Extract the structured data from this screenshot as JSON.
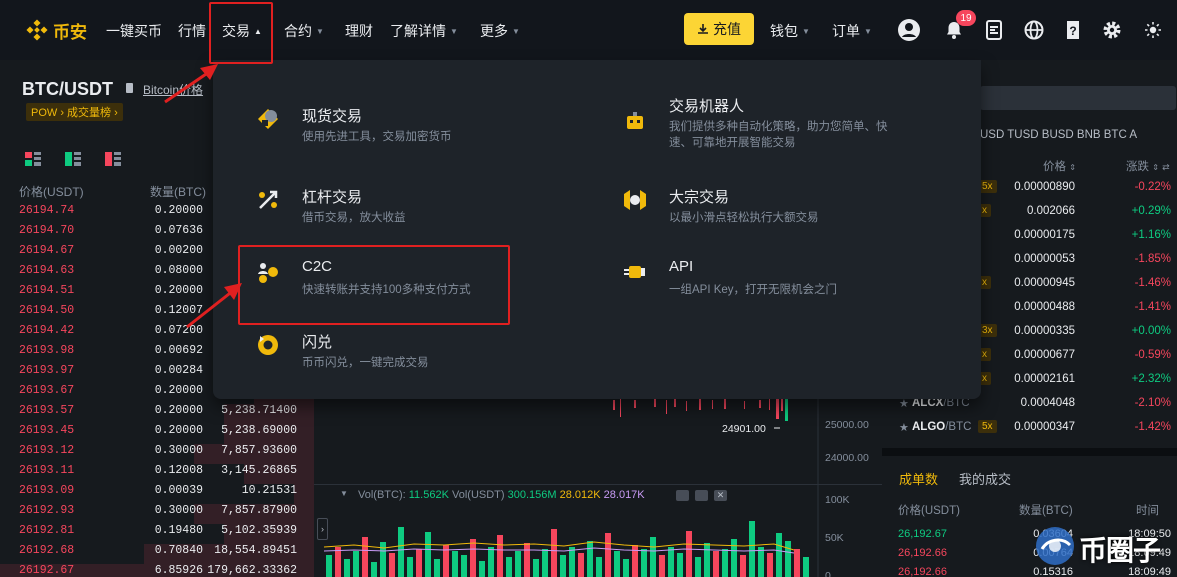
{
  "nav": {
    "logo_text": "币安",
    "items": [
      {
        "label": "一键买币",
        "caret": false
      },
      {
        "label": "行情",
        "caret": false
      },
      {
        "label": "交易",
        "caret": true,
        "active": true
      },
      {
        "label": "合约",
        "caret": true
      },
      {
        "label": "理财",
        "caret": false
      },
      {
        "label": "了解详情",
        "caret": true
      },
      {
        "label": "更多",
        "caret": true
      }
    ],
    "deposit_label": "充值",
    "wallet_label": "钱包",
    "orders_label": "订单",
    "notification_count": "19",
    "icons": [
      "user-icon",
      "bell-icon",
      "download-app-icon",
      "globe-icon",
      "help-icon",
      "settings-icon",
      "theme-icon"
    ],
    "colors": {
      "brand": "#f0b90b",
      "deposit_bg": "#fcd535",
      "badge": "#f6465d"
    }
  },
  "pair": {
    "symbol": "BTC/USDT",
    "link": "Bitcoin价格",
    "tag": "POW › 成交量榜 ›"
  },
  "orderbook": {
    "headers": {
      "price": "价格(USDT)",
      "qty": "数量(BTC)"
    },
    "rows": [
      {
        "price": "26194.74",
        "qty": "0.20000",
        "total": ""
      },
      {
        "price": "26194.70",
        "qty": "0.07636",
        "total": ""
      },
      {
        "price": "26194.67",
        "qty": "0.00200",
        "total": ""
      },
      {
        "price": "26194.63",
        "qty": "0.08000",
        "total": ""
      },
      {
        "price": "26194.51",
        "qty": "0.20000",
        "total": ""
      },
      {
        "price": "26194.50",
        "qty": "0.12007",
        "total": ""
      },
      {
        "price": "26194.42",
        "qty": "0.07200",
        "total": ""
      },
      {
        "price": "26193.98",
        "qty": "0.00692",
        "total": ""
      },
      {
        "price": "26193.97",
        "qty": "0.00284",
        "total": ""
      },
      {
        "price": "26193.67",
        "qty": "0.20000",
        "total": ""
      },
      {
        "price": "26193.57",
        "qty": "0.20000",
        "total": "5,238.71400"
      },
      {
        "price": "26193.45",
        "qty": "0.20000",
        "total": "5,238.69000"
      },
      {
        "price": "26193.12",
        "qty": "0.30000",
        "total": "7,857.93600"
      },
      {
        "price": "26193.11",
        "qty": "0.12008",
        "total": "3,145.26865"
      },
      {
        "price": "26193.09",
        "qty": "0.00039",
        "total": "10.21531"
      },
      {
        "price": "26192.93",
        "qty": "0.30000",
        "total": "7,857.87900"
      },
      {
        "price": "26192.81",
        "qty": "0.19480",
        "total": "5,102.35939"
      },
      {
        "price": "26192.68",
        "qty": "0.70840",
        "total": "18,554.89451"
      },
      {
        "price": "26192.67",
        "qty": "6.85926",
        "total": "179,662.33362"
      }
    ]
  },
  "chart": {
    "price_axis": [
      "25000.00",
      "24000.00"
    ],
    "low_label": "24901.00",
    "vol_axis": [
      "100K",
      "50K"
    ],
    "vol_legend": {
      "prefix": "Vol(BTC):",
      "btc": "11.562K",
      "usdt_prefix": "Vol(USDT)",
      "usdt": "300.156M",
      "ma1": "28.012K",
      "ma2": "28.017K"
    }
  },
  "dropdown": {
    "items": [
      {
        "title": "现货交易",
        "desc": "使用先进工具，交易加密货币",
        "icon": "spot-trading-icon"
      },
      {
        "title": "交易机器人",
        "desc": "我们提供多种自动化策略，助力您简单、快速、可靠地开展智能交易",
        "icon": "trading-bot-icon"
      },
      {
        "title": "杠杆交易",
        "desc": "借币交易，放大收益",
        "icon": "margin-trading-icon"
      },
      {
        "title": "大宗交易",
        "desc": "以最小滑点轻松执行大额交易",
        "icon": "block-trading-icon"
      },
      {
        "title": "C2C",
        "desc": "快速转账并支持100多种支付方式",
        "icon": "c2c-icon"
      },
      {
        "title": "API",
        "desc": "一组API Key，打开无限机会之门",
        "icon": "api-icon"
      },
      {
        "title": "闪兑",
        "desc": "币币闪兑，一键完成交易",
        "icon": "convert-icon"
      }
    ]
  },
  "market": {
    "tabs": "USD  TUSD  BUSD  BNB  BTC  A",
    "headers": {
      "price": "价格",
      "change": "涨跌"
    },
    "rows": [
      {
        "symbol": "",
        "quote": "",
        "lev": "5x",
        "price": "0.00000890",
        "change": "-0.22%",
        "up": false
      },
      {
        "symbol": "",
        "quote": "",
        "lev": "x",
        "price": "0.002066",
        "change": "+0.29%",
        "up": true
      },
      {
        "symbol": "",
        "quote": "",
        "lev": "",
        "price": "0.00000175",
        "change": "+1.16%",
        "up": true
      },
      {
        "symbol": "",
        "quote": "",
        "lev": "",
        "price": "0.00000053",
        "change": "-1.85%",
        "up": false
      },
      {
        "symbol": "",
        "quote": "",
        "lev": "x",
        "price": "0.00000945",
        "change": "-1.46%",
        "up": false
      },
      {
        "symbol": "",
        "quote": "",
        "lev": "",
        "price": "0.00000488",
        "change": "-1.41%",
        "up": false
      },
      {
        "symbol": "",
        "quote": "",
        "lev": "3x",
        "price": "0.00000335",
        "change": "+0.00%",
        "up": true
      },
      {
        "symbol": "",
        "quote": "",
        "lev": "x",
        "price": "0.00000677",
        "change": "-0.59%",
        "up": false
      },
      {
        "symbol": "",
        "quote": "",
        "lev": "x",
        "price": "0.00002161",
        "change": "+2.32%",
        "up": true
      },
      {
        "symbol": "ALCX",
        "quote": "/BTC",
        "lev": "",
        "price": "0.0004048",
        "change": "-2.10%",
        "up": false
      },
      {
        "symbol": "ALGO",
        "quote": "/BTC",
        "lev": "5x",
        "price": "0.00000347",
        "change": "-1.42%",
        "up": false
      }
    ],
    "colors": {
      "up": "#0ecb81",
      "down": "#f6465d"
    }
  },
  "trades": {
    "tab_active": "成单数",
    "tab_other": "我的成交",
    "headers": {
      "price": "价格(USDT)",
      "qty": "数量(BTC)",
      "time": "时间"
    },
    "rows": [
      {
        "price": "26,192.67",
        "qty": "0.03604",
        "time": "18:09:50",
        "up": true
      },
      {
        "price": "26,192.66",
        "qty": "0.00764",
        "time": "18:09:49",
        "up": false
      },
      {
        "price": "26,192.66",
        "qty": "0.15316",
        "time": "18:09:49",
        "up": false
      }
    ]
  },
  "watermark": {
    "text": "币圈子"
  }
}
